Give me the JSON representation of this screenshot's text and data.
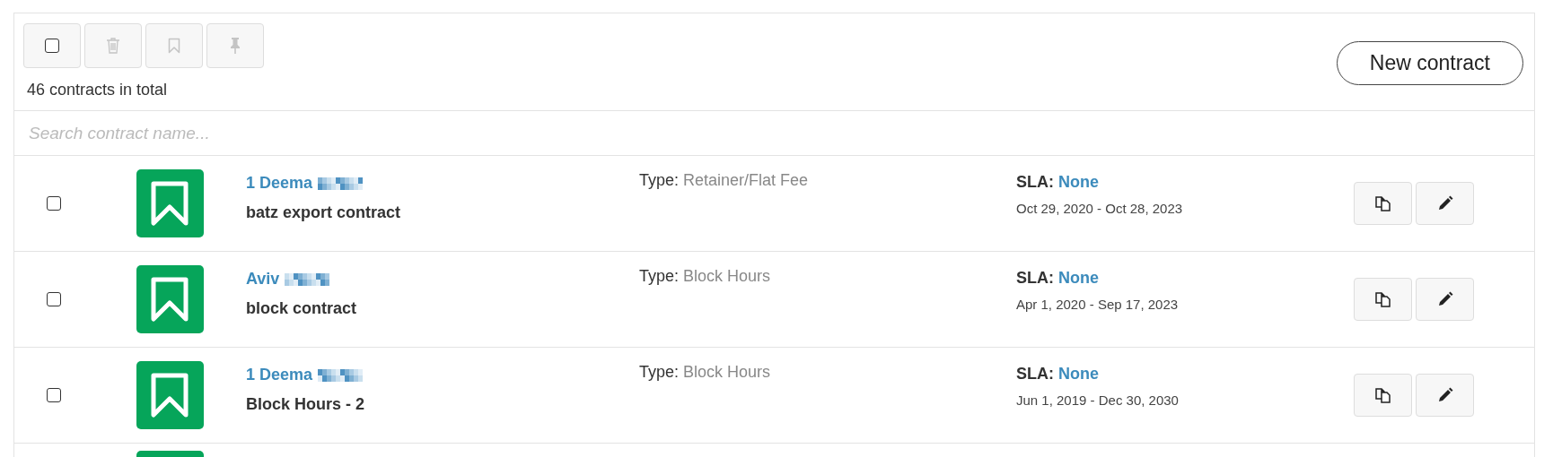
{
  "toolbar": {
    "select_all": {
      "checked": false
    },
    "actions": [
      {
        "kind": "delete",
        "disabled": true
      },
      {
        "kind": "bookmark",
        "disabled": true
      },
      {
        "kind": "pin",
        "disabled": true
      }
    ],
    "total": "46 contracts in total",
    "new_button": "New contract"
  },
  "search": {
    "placeholder": "Search contract name..."
  },
  "rows": [
    {
      "kind": "full",
      "checked": false,
      "client": "1 Deema",
      "contract": "batz export contract",
      "type_label": "Type:",
      "type": "Retainer/Flat Fee",
      "sla_label": "SLA:",
      "sla": "None",
      "dates": "Oct 29, 2020 - Oct 28, 2023"
    },
    {
      "kind": "full",
      "checked": false,
      "client": "Aviv",
      "contract": "block contract",
      "type_label": "Type:",
      "type": "Block Hours",
      "sla_label": "SLA:",
      "sla": "None",
      "dates": "Apr 1, 2020 - Sep 17, 2023"
    },
    {
      "kind": "full",
      "checked": false,
      "client": "1 Deema",
      "contract": "Block Hours - 2",
      "type_label": "Type:",
      "type": "Block Hours",
      "sla_label": "SLA:",
      "sla": "None",
      "dates": "Jun 1, 2019 - Dec 30, 2030"
    },
    {
      "kind": "cut"
    }
  ]
}
